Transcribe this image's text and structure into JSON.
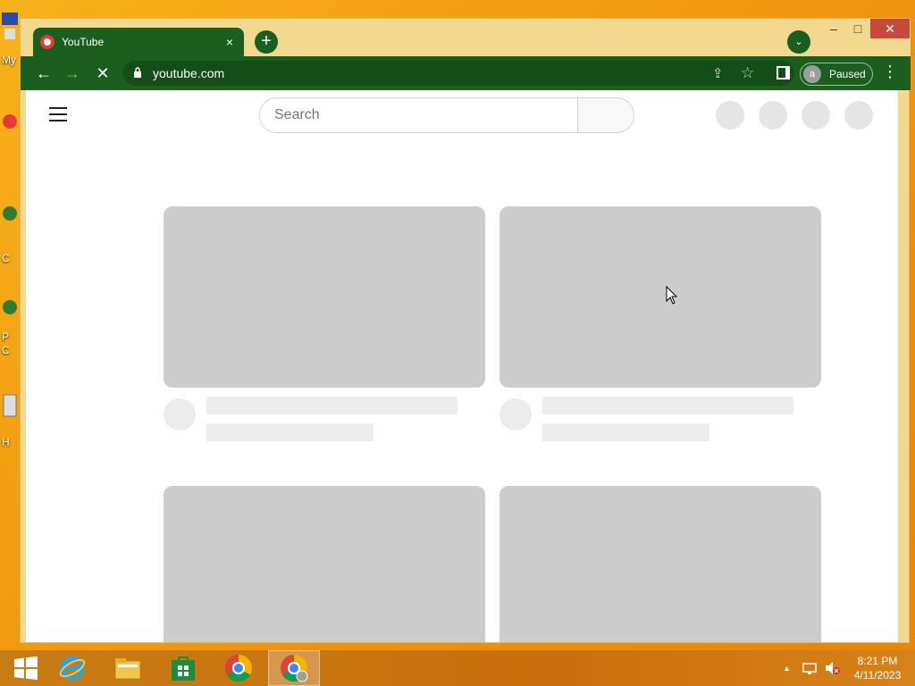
{
  "desktop": {
    "icon_labels": [
      "My",
      "C",
      "P",
      "C",
      "H"
    ]
  },
  "browser": {
    "tab": {
      "title": "YouTube",
      "close_glyph": "×"
    },
    "new_tab_glyph": "+",
    "tab_search_glyph": "⌄",
    "window_controls": {
      "minimize": "–",
      "maximize": "□",
      "close": "✕"
    },
    "nav": {
      "back_glyph": "←",
      "forward_glyph": "→",
      "stop_glyph": "✕"
    },
    "address": {
      "url": "youtube.com"
    },
    "actions": {
      "share_glyph": "⇪",
      "bookmark_glyph": "☆"
    },
    "profile": {
      "initial": "a",
      "status": "Paused"
    },
    "menu_glyph": "⋮"
  },
  "youtube": {
    "search": {
      "placeholder": "Search"
    }
  },
  "taskbar": {
    "apps": [
      "start",
      "internet-explorer",
      "file-explorer",
      "store",
      "chrome",
      "chrome-profile"
    ],
    "active_app": "chrome-profile",
    "tray": {
      "chevron": "▲"
    },
    "clock": {
      "time": "8:21 PM",
      "date": "4/11/2023"
    }
  },
  "colors": {
    "toolbar_green": "#1b5e20",
    "titlebar_tan": "#f1d98f",
    "close_red": "#c9483c",
    "placeholder_gray": "#cccccc",
    "desktop_orange": "#f29a0f"
  }
}
